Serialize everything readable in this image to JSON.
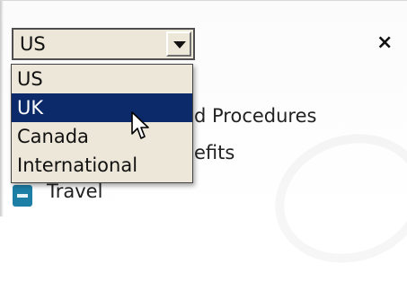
{
  "header": {
    "close_label": "×"
  },
  "country_select": {
    "value": "US",
    "options": [
      "US",
      "UK",
      "Canada",
      "International"
    ],
    "highlighted_option": "UK"
  },
  "background_menu": {
    "items": [
      {
        "label": "d Procedures"
      },
      {
        "label": "efits"
      },
      {
        "label": "Travel",
        "icon": "minus-square-icon"
      }
    ]
  },
  "colors": {
    "select_bg": "#ece7d8",
    "highlight_bg": "#0c2a6a",
    "icon_color": "#1e7fa6"
  }
}
